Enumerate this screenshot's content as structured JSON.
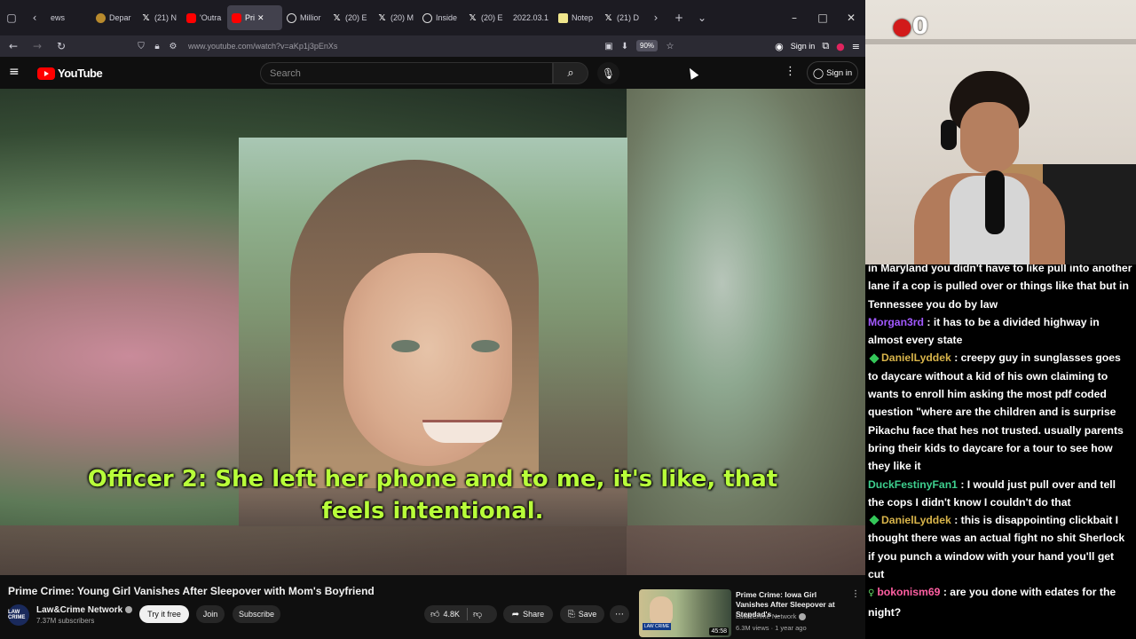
{
  "browser": {
    "tabs": [
      {
        "label": "ews",
        "icon": "none"
      },
      {
        "label": "Depar",
        "icon": "gov"
      },
      {
        "label": "(21) N",
        "icon": "x"
      },
      {
        "label": "'Outra",
        "icon": "yt"
      },
      {
        "label": "Pri",
        "icon": "yt",
        "active": true
      },
      {
        "label": "Millior",
        "icon": "circ"
      },
      {
        "label": "(20) E",
        "icon": "x"
      },
      {
        "label": "(20) M",
        "icon": "x"
      },
      {
        "label": "Inside",
        "icon": "circ"
      },
      {
        "label": "(20) E",
        "icon": "x"
      },
      {
        "label": "2022.03.1",
        "icon": "none"
      },
      {
        "label": "Notep",
        "icon": "note"
      },
      {
        "label": "(21) D",
        "icon": "x"
      }
    ],
    "url": "www.youtube.com/watch?v=aKp1j3pEnXs",
    "zoom": "90%",
    "sign_in": "Sign in"
  },
  "youtube": {
    "logo_text": "YouTube",
    "search_placeholder": "Search",
    "sign_in": "Sign in"
  },
  "video": {
    "caption_line1": "Officer 2: She left her phone and to me, it's like, that",
    "caption_line2": "feels intentional.",
    "title": "Prime Crime: Young Girl Vanishes After Sleepover with Mom's Boyfriend",
    "channel": "Law&Crime Network",
    "channel_avatar_text": "LAW CRIME",
    "subscribers": "7.37M subscribers",
    "try_label": "Try it free",
    "join_label": "Join",
    "subscribe_label": "Subscribe",
    "likes": "4.8K",
    "share_label": "Share",
    "save_label": "Save"
  },
  "recommended": {
    "title": "Prime Crime: Iowa Girl Vanishes After Sleepover at Stepdad's ...",
    "channel": "Law&Crime Network",
    "meta": "6.3M views · 1 year ago",
    "duration": "45:58",
    "badge": "LAW CRIME"
  },
  "stream": {
    "overlay_count": "0"
  },
  "chat": [
    {
      "user": "",
      "user_color": "#ffffff",
      "badge": "none",
      "text": "in Maryland you didn't have to like pull into another lane if a cop is pulled over or things like that but in Tennessee you do by law"
    },
    {
      "user": "Morgan3rd",
      "user_color": "#a259ff",
      "badge": "none",
      "text": ": it has to be a divided highway in almost every state"
    },
    {
      "user": "DanielLyddek",
      "user_color": "#d8b44a",
      "badge": "gem",
      "text": ": creepy guy in sunglasses goes to daycare without a kid of his own claiming to wants to enroll him asking the most pdf coded question \"where are the children and is surprise Pikachu face that hes not trusted. usually parents bring their kids to daycare for a tour to see how they like it"
    },
    {
      "user": "DuckFestinyFan1",
      "user_color": "#3ecf8e",
      "badge": "none",
      "text": ": I would just pull over and tell the cops I didn't know I couldn't do that"
    },
    {
      "user": "DanielLyddek",
      "user_color": "#d8b44a",
      "badge": "gem",
      "text": ": this is disappointing clickbait I thought there was an actual fight no shit Sherlock if you punch a window with your hand you'll get cut"
    },
    {
      "user": "bokonism69",
      "user_color": "#ff5fa2",
      "badge": "person",
      "text": ": are you done with edates for the night?"
    }
  ]
}
